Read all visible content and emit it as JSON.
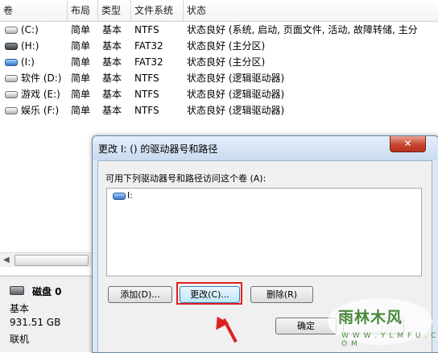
{
  "columns": [
    "卷",
    "布局",
    "类型",
    "文件系统",
    "状态"
  ],
  "volumes": [
    {
      "name": "(C:)",
      "layout": "简单",
      "type": "基本",
      "fs": "NTFS",
      "status": "状态良好 (系统, 启动, 页面文件, 活动, 故障转储, 主分",
      "icon": "drive-icon"
    },
    {
      "name": "(H:)",
      "layout": "简单",
      "type": "基本",
      "fs": "FAT32",
      "status": "状态良好 (主分区)",
      "icon": "drive-icon"
    },
    {
      "name": "(I:)",
      "layout": "简单",
      "type": "基本",
      "fs": "FAT32",
      "status": "状态良好 (主分区)",
      "icon": "removable-drive-icon"
    },
    {
      "name": "软件 (D:)",
      "layout": "简单",
      "type": "基本",
      "fs": "NTFS",
      "status": "状态良好 (逻辑驱动器)",
      "icon": "drive-icon"
    },
    {
      "name": "游戏 (E:)",
      "layout": "简单",
      "type": "基本",
      "fs": "NTFS",
      "status": "状态良好 (逻辑驱动器)",
      "icon": "drive-icon"
    },
    {
      "name": "娱乐 (F:)",
      "layout": "简单",
      "type": "基本",
      "fs": "NTFS",
      "status": "状态良好 (逻辑驱动器)",
      "icon": "drive-icon"
    }
  ],
  "disk": {
    "name": "磁盘 0",
    "type": "基本",
    "size": "931.51 GB",
    "state": "联机"
  },
  "dialog": {
    "title": "更改 I: () 的驱动器号和路径",
    "close_label": "✕",
    "label": "可用下列驱动器号和路径访问这个卷 (A):",
    "path_item": "I:",
    "add_label": "添加(D)...",
    "change_label": "更改(C)...",
    "remove_label": "删除(R)",
    "ok_label": "确定",
    "cancel_label": ""
  },
  "watermark": {
    "text": "雨林木风",
    "url": "W W W . Y L M F U . C O M"
  }
}
